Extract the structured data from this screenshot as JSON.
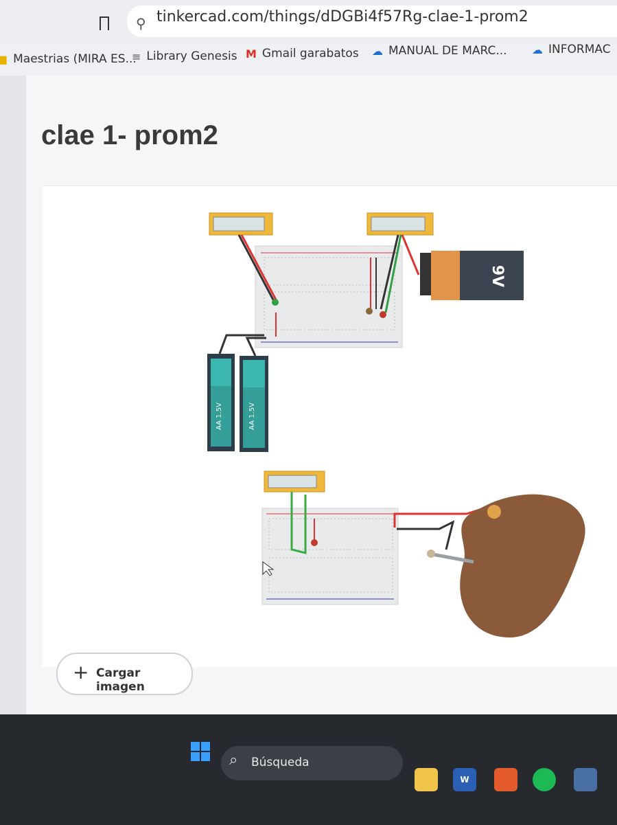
{
  "browser": {
    "url": "tinkercad.com/things/dDGBi4f57Rg-clae-1-prom2",
    "bookmarks": [
      {
        "label": "Maestrias (MIRA ES...",
        "icon": "folder-icon"
      },
      {
        "label": "Library Genesis",
        "icon": "library-icon"
      },
      {
        "label": "Gmail garabatos",
        "icon": "gmail-icon"
      },
      {
        "label": "MANUAL DE MARC...",
        "icon": "cloud-icon"
      },
      {
        "label": "INFORMAC",
        "icon": "cloud-icon"
      }
    ]
  },
  "page": {
    "title": "clae 1- prom2",
    "upload_button": "Cargar imagen"
  },
  "circuit": {
    "battery_9v_label": "9V",
    "aa_battery_label_1": "AA 1.5V",
    "aa_battery_label_2": "AA 1.5V"
  },
  "taskbar": {
    "search_placeholder": "Búsqueda",
    "apps": [
      "file-explorer-icon",
      "word-icon",
      "brave-icon",
      "spotify-icon",
      "app-icon"
    ]
  },
  "colors": {
    "accent_blue": "#1f6fd1",
    "breadboard": "#e9eaeb",
    "battery_teal": "#3bb7b0",
    "potato": "#8a5a3a"
  }
}
